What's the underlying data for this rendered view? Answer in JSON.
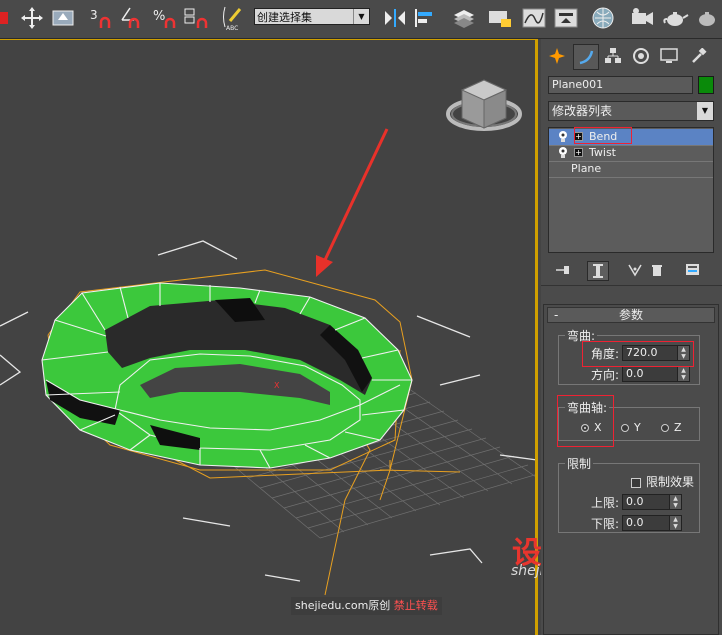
{
  "toolbar": {
    "named_selection_set": "创建选择集",
    "snap_3_label": "3",
    "snap_percent_label": "%"
  },
  "command_panel": {
    "object_name": "Plane001",
    "object_color": "#0a8a0a",
    "modifier_list_label": "修改器列表",
    "stack": [
      {
        "label": "Bend",
        "selected": true,
        "icons": [
          "bulb-icon",
          "plus-icon"
        ]
      },
      {
        "label": "Twist",
        "selected": false,
        "icons": [
          "bulb-icon",
          "plus-icon"
        ]
      },
      {
        "label": "Plane",
        "selected": false,
        "icons": []
      }
    ],
    "rollout": {
      "collapse_symbol": "-",
      "title": "参数",
      "bend_group": {
        "title": "弯曲:",
        "angle_label": "角度:",
        "angle_value": "720.0",
        "direction_label": "方向:",
        "direction_value": "0.0"
      },
      "bend_axis_group": {
        "title": "弯曲轴:",
        "options": [
          "X",
          "Y",
          "Z"
        ],
        "selected": "X"
      },
      "limits_group": {
        "title": "限制",
        "limit_effect_label": "限制效果",
        "limit_effect_checked": false,
        "upper_label": "上限:",
        "upper_value": "0.0",
        "lower_label": "下限:",
        "lower_value": "0.0"
      }
    }
  },
  "viewport": {
    "selected_color": "#e8a020",
    "object_color": "#3cc83c",
    "gizmo_axis_label": "X"
  },
  "watermarks": {
    "logo": "设解读",
    "site": "shejiedu.com",
    "credit_prefix": "shejiedu.com原创",
    "credit_suffix": "禁止转载"
  },
  "colors": {
    "accent_red": "#e23",
    "selection_blue": "#5b83c4",
    "viewport_border": "#d0a000"
  }
}
